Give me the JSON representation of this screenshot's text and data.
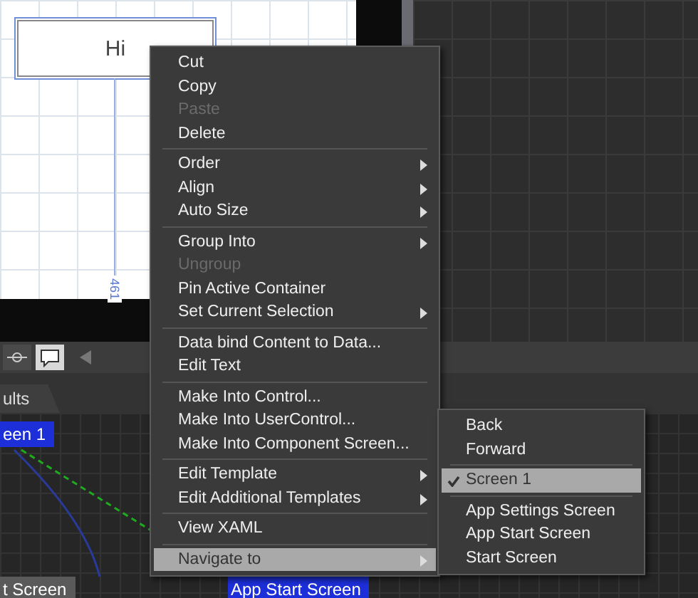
{
  "artboard": {
    "text_box": "Hi",
    "measure": "461"
  },
  "tab": {
    "label": "ults"
  },
  "flow_nodes": [
    {
      "label": "een 1",
      "selected": true
    },
    {
      "label": "t Screen",
      "selected": false
    },
    {
      "label": "App Start Screen",
      "selected": true
    }
  ],
  "context_menu": {
    "groups": [
      [
        {
          "label": "Cut",
          "disabled": false,
          "has_submenu": false,
          "selected": false
        },
        {
          "label": "Copy",
          "disabled": false,
          "has_submenu": false,
          "selected": false
        },
        {
          "label": "Paste",
          "disabled": true,
          "has_submenu": false,
          "selected": false
        },
        {
          "label": "Delete",
          "disabled": false,
          "has_submenu": false,
          "selected": false
        }
      ],
      [
        {
          "label": "Order",
          "disabled": false,
          "has_submenu": true,
          "selected": false
        },
        {
          "label": "Align",
          "disabled": false,
          "has_submenu": true,
          "selected": false
        },
        {
          "label": "Auto Size",
          "disabled": false,
          "has_submenu": true,
          "selected": false
        }
      ],
      [
        {
          "label": "Group Into",
          "disabled": false,
          "has_submenu": true,
          "selected": false
        },
        {
          "label": "Ungroup",
          "disabled": true,
          "has_submenu": false,
          "selected": false
        },
        {
          "label": "Pin Active Container",
          "disabled": false,
          "has_submenu": false,
          "selected": false
        },
        {
          "label": "Set Current Selection",
          "disabled": false,
          "has_submenu": true,
          "selected": false
        }
      ],
      [
        {
          "label": "Data bind Content to Data...",
          "disabled": false,
          "has_submenu": false,
          "selected": false
        },
        {
          "label": "Edit Text",
          "disabled": false,
          "has_submenu": false,
          "selected": false
        }
      ],
      [
        {
          "label": "Make Into Control...",
          "disabled": false,
          "has_submenu": false,
          "selected": false
        },
        {
          "label": "Make Into UserControl...",
          "disabled": false,
          "has_submenu": false,
          "selected": false
        },
        {
          "label": "Make Into Component Screen...",
          "disabled": false,
          "has_submenu": false,
          "selected": false
        }
      ],
      [
        {
          "label": "Edit Template",
          "disabled": false,
          "has_submenu": true,
          "selected": false
        },
        {
          "label": "Edit Additional Templates",
          "disabled": false,
          "has_submenu": true,
          "selected": false
        }
      ],
      [
        {
          "label": "View XAML",
          "disabled": false,
          "has_submenu": false,
          "selected": false
        }
      ],
      [
        {
          "label": "Navigate to",
          "disabled": false,
          "has_submenu": true,
          "selected": true
        }
      ]
    ]
  },
  "submenu": {
    "groups": [
      [
        {
          "label": "Back",
          "checked": false,
          "selected": false
        },
        {
          "label": "Forward",
          "checked": false,
          "selected": false
        }
      ],
      [
        {
          "label": "Screen 1",
          "checked": true,
          "selected": true
        }
      ],
      [
        {
          "label": "App Settings Screen",
          "checked": false,
          "selected": false
        },
        {
          "label": "App Start Screen",
          "checked": false,
          "selected": false
        },
        {
          "label": "Start Screen",
          "checked": false,
          "selected": false
        }
      ]
    ]
  }
}
